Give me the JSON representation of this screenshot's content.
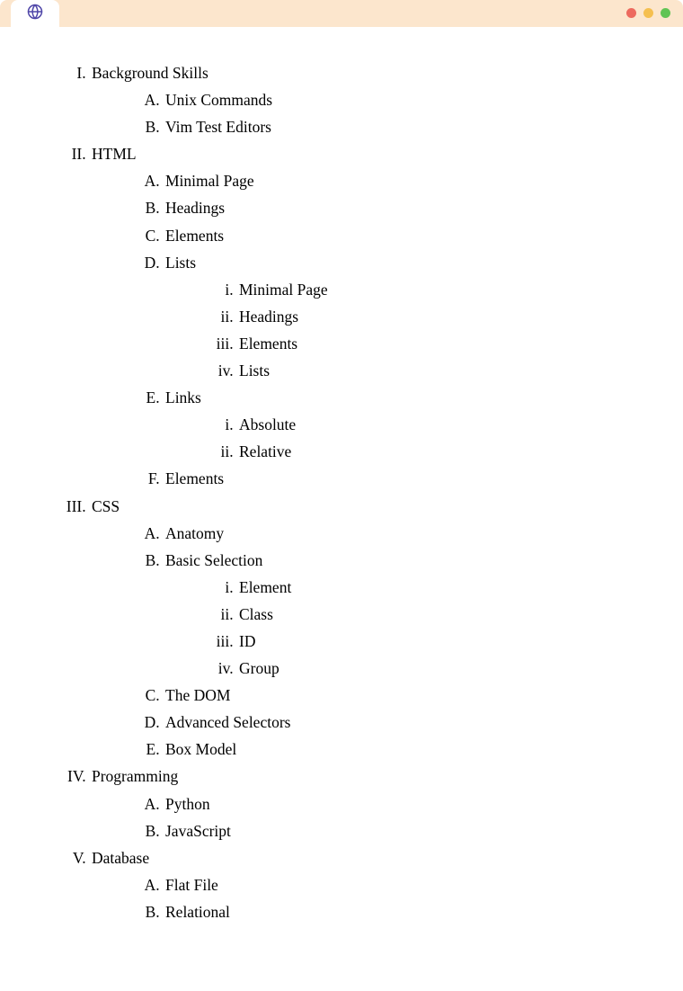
{
  "outline": [
    {
      "label": "Background Skills",
      "children": [
        {
          "label": "Unix Commands"
        },
        {
          "label": "Vim Test Editors"
        }
      ]
    },
    {
      "label": "HTML",
      "children": [
        {
          "label": "Minimal Page"
        },
        {
          "label": "Headings"
        },
        {
          "label": "Elements"
        },
        {
          "label": "Lists",
          "children": [
            {
              "label": "Minimal Page"
            },
            {
              "label": "Headings"
            },
            {
              "label": "Elements"
            },
            {
              "label": "Lists"
            }
          ]
        },
        {
          "label": "Links",
          "children": [
            {
              "label": "Absolute"
            },
            {
              "label": "Relative"
            }
          ]
        },
        {
          "label": "Elements"
        }
      ]
    },
    {
      "label": "CSS",
      "children": [
        {
          "label": "Anatomy"
        },
        {
          "label": "Basic Selection",
          "children": [
            {
              "label": "Element"
            },
            {
              "label": "Class"
            },
            {
              "label": "ID"
            },
            {
              "label": "Group"
            }
          ]
        },
        {
          "label": "The DOM"
        },
        {
          "label": "Advanced Selectors"
        },
        {
          "label": "Box Model"
        }
      ]
    },
    {
      "label": "Programming",
      "children": [
        {
          "label": "Python"
        },
        {
          "label": "JavaScript"
        }
      ]
    },
    {
      "label": "Database",
      "children": [
        {
          "label": "Flat File"
        },
        {
          "label": "Relational"
        }
      ]
    }
  ]
}
